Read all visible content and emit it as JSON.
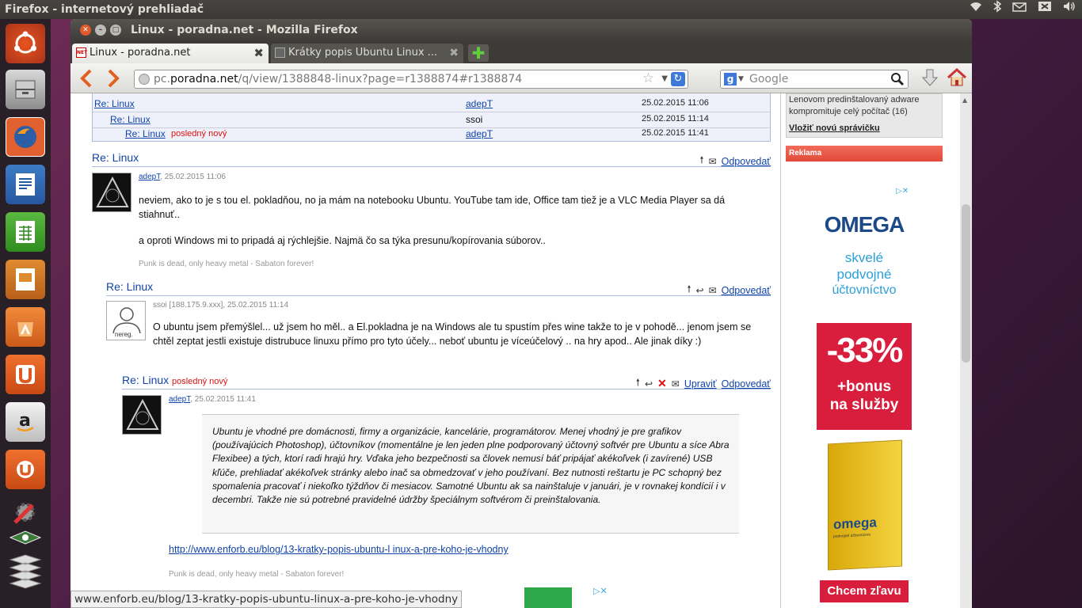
{
  "system": {
    "app_title": "Firefox - internetový prehliadač"
  },
  "window": {
    "title": "Linux - poradna.net - Mozilla Firefox"
  },
  "tabs": [
    {
      "label": "Linux - poradna.net"
    },
    {
      "label": "Krátky popis Ubuntu Linux ..."
    }
  ],
  "navbar": {
    "url_prefix": "pc.",
    "url_domain": "poradna.net",
    "url_path": "/q/view/1388848-linux?page=r1388874#r1388874",
    "search_placeholder": "Google"
  },
  "thread_list": [
    {
      "title": "Re: Linux",
      "author": "adepT",
      "date": "25.02.2015 11:06",
      "new": ""
    },
    {
      "title": "Re: Linux",
      "author": "ssoi",
      "date": "25.02.2015 11:14",
      "new": ""
    },
    {
      "title": "Re: Linux",
      "author": "adepT",
      "date": "25.02.2015 11:41",
      "new": "posledný nový"
    }
  ],
  "posts": [
    {
      "title": "Re: Linux",
      "author": "adepT",
      "date": ", 25.02.2015 11:06",
      "reply": "Odpovedať",
      "text1": "neviem, ako to je s tou el. pokladňou, no ja mám na notebooku Ubuntu. YouTube tam ide, Office tam tiež je a VLC Media Player sa dá stiahnuť..",
      "text2": "a oproti Windows mi to pripadá aj rýchlejšie. Najmä čo sa týka presunu/kopírovania súborov..",
      "sig": "Punk is dead, only heavy metal - Sabaton forever!"
    },
    {
      "title": "Re: Linux",
      "author": "ssoi [188.175.9.xxx]",
      "date": ", 25.02.2015 11:14",
      "reply": "Odpovedať",
      "avatar_label": "nereg.",
      "text1": "O ubuntu jsem přemýšlel... už jsem ho měl.. a El.pokladna je na Windows ale tu spustím přes wine takže to je v pohodě... jenom jsem se chtěl zeptat jestli existuje distrubuce linuxu přímo pro tyto účely... neboť ubuntu je víceúčelový .. na hry apod.. Ale jinak díky :)"
    },
    {
      "title": "Re: Linux",
      "new": "posledný nový",
      "author": "adepT",
      "date": ", 25.02.2015 11:41",
      "edit": "Upraviť",
      "reply": "Odpovedať",
      "quote": "Ubuntu je vhodné pre domácnosti, firmy a organizácie, kancelárie, programátorov. Menej vhodný je pre grafikov (používajúcich Photoshop), účtovníkov (momentálne je len jeden plne podporovaný účtovný softvér pre Ubuntu a síce Abra Flexibee) a tých, ktorí radi hrajú hry. Vďaka jeho bezpečnosti sa človek nemusí báť pripájať akékoľvek (i zavírené) USB kľúče, prehliadať akékoľvek stránky alebo inač sa obmedzovať v jeho používaní. Bez nutnosti reštartu je PC schopný bez spomalenia pracovať i niekoľko týždňov či mesiacov. Samotné Ubuntu ak sa nainštaluje v januári, je v rovnakej kondícií i v decembri. Takže nie sú potrebné pravidelné údržby špeciálnym softvérom či preinštalovania.",
      "link": "http://www.enforb.eu/blog/13-kratky-popis-ubuntu-l inux-a-pre-koho-je-vhodny",
      "sig": "Punk is dead, only heavy metal - Sabaton forever!"
    }
  ],
  "sidebar": {
    "news_line1": "Lenovom predinštalovaný adware",
    "news_line2": "kompromituje celý počítač",
    "news_count": "(16)",
    "new_news_link": "Vložiť novú správičku",
    "ad_header": "Reklama",
    "ad": {
      "brand": "OMEGA",
      "line1": "skvelé",
      "line2": "podvojné",
      "line3": "účtovníctvo",
      "discount": "-33%",
      "bonus1": "+bonus",
      "bonus2": "na služby",
      "box_brand": "omega",
      "box_sub": "podvojné účtovníctvo",
      "cta": "Chcem zľavu"
    }
  },
  "status_bar": {
    "text": "www.enforb.eu/blog/13-kratky-popis-ubuntu-linux-a-pre-koho-je-vhodny"
  }
}
